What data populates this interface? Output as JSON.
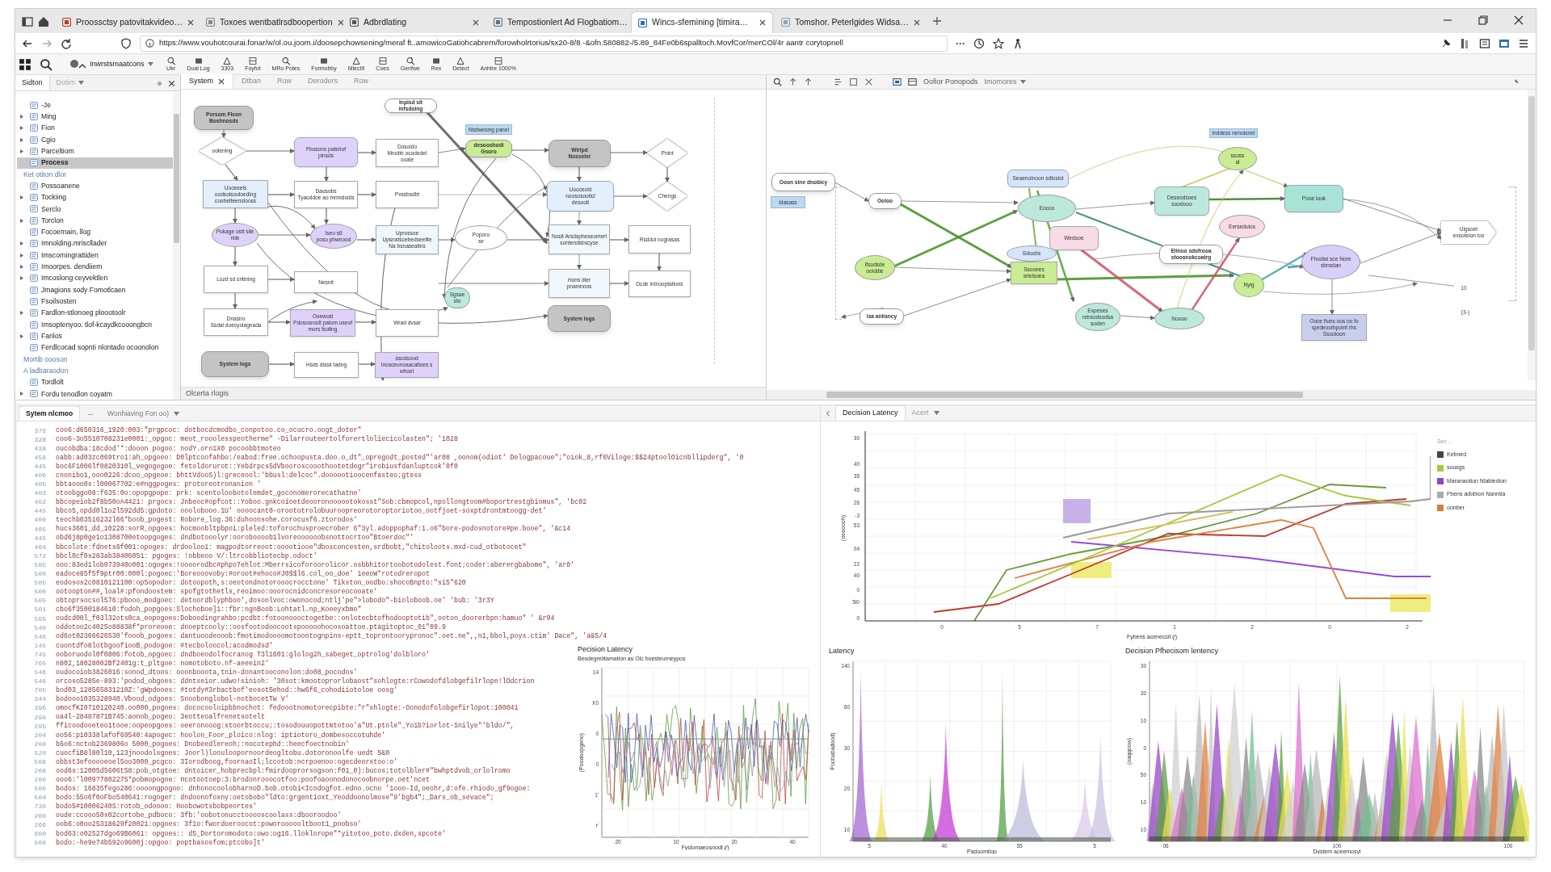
{
  "browser": {
    "tabs": [
      {
        "title": "Proossctsy patovitakvideo…",
        "selected": false
      },
      {
        "title": "Toxoes wentbatlrsdboopertion",
        "selected": false
      },
      {
        "title": "Adbrdlating",
        "selected": false
      },
      {
        "title": "Tempostionlert Ad Flogbatiom…",
        "selected": false
      },
      {
        "title": "Wincs-sfemining [timira…",
        "selected": true
      },
      {
        "title": "Tomshor. Peterlgides Widsa…",
        "selected": false
      }
    ],
    "url": "https://www.vouhotcourai.fonar/w/ol.ou.joom.i/doosepchowsening/meraf ft..amowicoGatiohcabrern/forowholrtorius/sx20-8/8 -&ofn.580882-/5.89_84Fe0b6spalltoch.MovfCor/merCOl/4r aantr corytopnell",
    "more": "···"
  },
  "toolbar": {
    "items": [
      {
        "label": "Inwrstsmaatcons"
      },
      {
        "label": "Ukr"
      },
      {
        "label": "Dual Log"
      },
      {
        "label": "3303"
      },
      {
        "label": "Foyfot"
      },
      {
        "label": "MRo",
        "sub": "Potes"
      },
      {
        "label": "Formobby"
      },
      {
        "label": "Mlect9"
      },
      {
        "label": "Coes"
      },
      {
        "label": "Genfwe"
      },
      {
        "label": "Rex"
      },
      {
        "label": "Detect"
      },
      {
        "label": "Anhtre",
        "sub": "1000%"
      }
    ]
  },
  "sidebar": {
    "tabs": [
      {
        "label": "Sidton",
        "selected": true
      },
      {
        "label": "Dotim",
        "selected": false
      }
    ],
    "items": [
      {
        "kind": "item",
        "label": "-Je",
        "expandable": false,
        "selected": false
      },
      {
        "kind": "item",
        "label": "Ming",
        "expandable": true,
        "selected": false
      },
      {
        "kind": "item",
        "label": "Fion",
        "expandable": true,
        "selected": false
      },
      {
        "kind": "item",
        "label": "Cgio",
        "expandable": true,
        "selected": false
      },
      {
        "kind": "item",
        "label": "Parceltiom",
        "expandable": true,
        "selected": false
      },
      {
        "kind": "item",
        "label": "Process",
        "expandable": false,
        "selected": true
      },
      {
        "kind": "heading",
        "label": "Ket otiton dlor",
        "expandable": false,
        "selected": false
      },
      {
        "kind": "item",
        "label": "Possoanene",
        "expandable": false,
        "selected": false
      },
      {
        "kind": "item",
        "label": "Tockiing",
        "expandable": true,
        "selected": false
      },
      {
        "kind": "item",
        "label": "Serclo",
        "expandable": false,
        "selected": false
      },
      {
        "kind": "item",
        "label": "Torclon",
        "expandable": true,
        "selected": false
      },
      {
        "kind": "item",
        "label": "Focoernain, llog",
        "expandable": false,
        "selected": false
      },
      {
        "kind": "item",
        "label": "Imnolding.mriscllader",
        "expandable": true,
        "selected": false
      },
      {
        "kind": "item",
        "label": "Imscorningrattiden",
        "expandable": true,
        "selected": false
      },
      {
        "kind": "item",
        "label": "Imoorpes. dendiiem",
        "expandable": true,
        "selected": false
      },
      {
        "kind": "item",
        "label": "Imcoslong ceyvektlen",
        "expandable": true,
        "selected": false
      },
      {
        "kind": "item",
        "label": "Jmagions sody Fomotlcaen",
        "expandable": false,
        "selected": false
      },
      {
        "kind": "item",
        "label": "Fsoilsosten",
        "expandable": false,
        "selected": false
      },
      {
        "kind": "item",
        "label": "Fardlon-stlonoeg ploootoolr",
        "expandable": true,
        "selected": false
      },
      {
        "kind": "item",
        "label": "Imsoptenyoo. tlof-kcaydkcooongbcn",
        "expandable": false,
        "selected": false
      },
      {
        "kind": "item",
        "label": "Fanlos",
        "expandable": true,
        "selected": false
      },
      {
        "kind": "item",
        "label": "Ferdlcocad sopnti nlontado ocoonolon",
        "expandable": false,
        "selected": false
      },
      {
        "kind": "heading",
        "label": "Mortib oooson",
        "expandable": false,
        "selected": false
      },
      {
        "kind": "heading",
        "label": "A ladbaraodon",
        "expandable": false,
        "selected": false
      },
      {
        "kind": "item",
        "label": "Tordlolt",
        "expandable": false,
        "selected": false
      },
      {
        "kind": "item",
        "label": "Fordu tenodlon coyatm",
        "expandable": true,
        "selected": false
      }
    ]
  },
  "diagram": {
    "tabs": [
      {
        "label": "System",
        "selected": true
      },
      {
        "label": "Dtban",
        "selected": false
      },
      {
        "label": "Row",
        "selected": false
      },
      {
        "label": "Deroders",
        "selected": false
      },
      {
        "label": "Row",
        "selected": false
      }
    ],
    "nodes": [
      {
        "kind": "pill",
        "color": "#ffffff",
        "lines": [
          "Inpisd sit infsdoing"
        ]
      },
      {
        "kind": "pill",
        "color": "#c4c4c4",
        "lines": [
          "Porsom Fleon",
          "Boshnosds"
        ]
      },
      {
        "kind": "diamond",
        "color": "#ffffff",
        "lines": [
          "oolening"
        ]
      },
      {
        "kind": "rounded",
        "color": "#ded2fb",
        "lines": [
          "Fbosons pateriof",
          "pinsds"
        ]
      },
      {
        "kind": "rect",
        "color": "#ffffff",
        "lines": [
          "Dosoido",
          "Mnobb ocodedel",
          "ooale"
        ]
      },
      {
        "kind": "label",
        "color": "#bcd8f2",
        "lines": [
          "Nistwesing panel"
        ]
      },
      {
        "kind": "pill",
        "color": "#c9ec94",
        "lines": [
          "desooshodi",
          "Gsoro"
        ]
      },
      {
        "kind": "pill",
        "color": "#c4c4c4",
        "lines": [
          "Wirlpd",
          "Nosseler"
        ]
      },
      {
        "kind": "diamond",
        "color": "#ffffff",
        "lines": [
          "Pnint"
        ]
      },
      {
        "kind": "rect",
        "color": "#e3effc",
        "lines": [
          "Uooseels",
          "oodsolsouloeding",
          "coobetteenslooss"
        ]
      },
      {
        "kind": "rect",
        "color": "#ffffff",
        "lines": [
          "Daosobs",
          "Tyaoddoe ao mnnidodis"
        ]
      },
      {
        "kind": "rect",
        "color": "#ffffff",
        "lines": [
          "Pxssbsdbt"
        ]
      },
      {
        "kind": "rounded",
        "color": "#e3effc",
        "lines": [
          "Uooceold",
          "noososooticl",
          "desooit"
        ]
      },
      {
        "kind": "diamond",
        "color": "#ffffff",
        "lines": [
          "Chengs"
        ]
      },
      {
        "kind": "ellipse",
        "color": "#ded2fb",
        "lines": [
          "Pukage ostt sile",
          "ride"
        ]
      },
      {
        "kind": "ellipse",
        "color": "#ded2fb",
        "lines": [
          "Iseo s6",
          "poso phwnood"
        ]
      },
      {
        "kind": "rect",
        "color": "#f0f8fd",
        "lines": [
          "Uprossoe",
          "Upsnatscebedseelite",
          "Na bsnaseatins"
        ]
      },
      {
        "kind": "ellipse",
        "color": "#ffffff",
        "lines": [
          "Poporo",
          "se"
        ]
      },
      {
        "kind": "rect",
        "color": "#f0f8fd",
        "lines": [
          "Nosit Arsdspheseomert",
          "sontendsbscyse"
        ]
      },
      {
        "kind": "rect",
        "color": "#ffffff",
        "lines": [
          "Rsddoi nograsas"
        ]
      },
      {
        "kind": "rect",
        "color": "#ffffff",
        "lines": [
          "Lozd sd sntining"
        ]
      },
      {
        "kind": "rect",
        "color": "#ffffff",
        "lines": [
          "Nesnit"
        ]
      },
      {
        "kind": "circle",
        "color": "#bde9dd",
        "lines": [
          "Sgsae",
          "sto"
        ]
      },
      {
        "kind": "rect",
        "color": "#f0f8fd",
        "lines": [
          "Hons dier",
          "pnamnnos"
        ]
      },
      {
        "kind": "rect",
        "color": "#ffffff",
        "lines": [
          "Dcde intnooptations"
        ]
      },
      {
        "kind": "rect",
        "color": "#ffffff",
        "lines": [
          "Dnasiro",
          "Ssdal doecyolagnada"
        ]
      },
      {
        "kind": "rect",
        "color": "#ded2fb",
        "lines": [
          "Ooewosl",
          "Pdososnodt patom useof",
          "mors fsoltng"
        ]
      },
      {
        "kind": "rect",
        "color": "#ffffff",
        "lines": [
          "Wrad dvsar"
        ]
      },
      {
        "kind": "pill",
        "color": "#c4c4c4",
        "lines": [
          "System logs"
        ]
      },
      {
        "kind": "pill",
        "color": "#c4c4c4",
        "lines": [
          "System logs"
        ]
      },
      {
        "kind": "rect",
        "color": "#ffffff",
        "lines": [
          "Hsds dissk tadng"
        ]
      },
      {
        "kind": "rect",
        "color": "#ded2fb",
        "lines": [
          "ssodsood",
          "Inosceunoaacatioes s whoel"
        ]
      }
    ],
    "status": "Olcerta rlogis"
  },
  "graph": {
    "toolbar": {
      "labels": [
        "Oofior Ponopods",
        "Imomores"
      ]
    },
    "nodes": [
      {
        "kind": "pill",
        "color": "#ffffff",
        "lines": [
          "Ooon sine dnobicy"
        ]
      },
      {
        "kind": "label",
        "color": "#bcd8f2",
        "lines": [
          "ldasass"
        ]
      },
      {
        "kind": "pill",
        "color": "#ffffff",
        "lines": [
          "Ooloo"
        ]
      },
      {
        "kind": "ellipse",
        "color": "#c9ec94",
        "lines": [
          "Ifsodsde",
          "ooiddie"
        ]
      },
      {
        "kind": "pill",
        "color": "#ffffff",
        "lines": [
          "lsa aniisncy"
        ]
      },
      {
        "kind": "rounded",
        "color": "#d6e6fa",
        "lines": [
          "Seaenoinoon sdtcsiot"
        ]
      },
      {
        "kind": "ellipse",
        "color": "#bde9dd",
        "lines": [
          "Eocoo"
        ]
      },
      {
        "kind": "rounded",
        "color": "#f8dbe4",
        "lines": [
          "Wedooe"
        ]
      },
      {
        "kind": "ellipse",
        "color": "#d6e6fa",
        "lines": [
          "Sdoobs"
        ]
      },
      {
        "kind": "rect",
        "color": "#c9ec94",
        "lines": [
          "Ssooees",
          "srlelsoea"
        ]
      },
      {
        "kind": "ellipse",
        "color": "#bde9dd",
        "lines": [
          "Expeses",
          "rebsodsodsa",
          "soden"
        ]
      },
      {
        "kind": "rounded",
        "color": "#bde9dd",
        "lines": [
          "Deseodsoes",
          "soodooo"
        ]
      },
      {
        "kind": "label",
        "color": "#bcd8f2",
        "lines": [
          "inddess nenoisnel"
        ]
      },
      {
        "kind": "ellipse",
        "color": "#c9ec94",
        "lines": [
          "ssoss",
          "al"
        ]
      },
      {
        "kind": "ellipse",
        "color": "#f8dbe4",
        "lines": [
          "Eersedulos"
        ]
      },
      {
        "kind": "pill",
        "color": "#ffffff",
        "lines": [
          "Elinoo sdofrooa",
          "stoosnokcoatrg"
        ]
      },
      {
        "kind": "ellipse",
        "color": "#c9ec94",
        "lines": [
          "Nyig"
        ]
      },
      {
        "kind": "ellipse",
        "color": "#bde9dd",
        "lines": [
          "Noooo"
        ]
      },
      {
        "kind": "rounded",
        "color": "#a8e4d6",
        "lines": [
          "Pooe look"
        ]
      },
      {
        "kind": "ellipse",
        "color": "#d8d0f8",
        "lines": [
          "Fhodiai sce Nore",
          "sbnsdan"
        ]
      },
      {
        "kind": "rect",
        "color": "#c8cfee",
        "lines": [
          "Ooce fiuns ous oo fo",
          "sprdeoorbpoint rhs",
          "Ssooloon"
        ]
      },
      {
        "kind": "tag",
        "color": "#ffffff",
        "lines": [
          "Uigsoet",
          "exsoteion ios"
        ]
      },
      {
        "kind": "text",
        "lines": [
          "10"
        ]
      },
      {
        "kind": "text",
        "lines": [
          "(3-)"
        ]
      }
    ]
  },
  "console": {
    "tabs": [
      {
        "label": "Sytem nlcmoo",
        "selected": true
      },
      {
        "label": "Wonhiaving Fon oo)",
        "selected": false
      }
    ],
    "lines": [
      {
        "number": "376",
        "text": "coo6:d650316_1920:003:\"prgpcoc: dotbocdcmodbo_conpotoo.co_ocucro.oogt_doter\""
      },
      {
        "number": "328",
        "text": "coo6-3o5510708231e0001:_opgoc: meot_rooolesspeotherme\" -Dilarrouteertolforertloliecicolasten\"; '1028"
      },
      {
        "number": "438",
        "text": "oucobdba:18cdod'*:dooon pogoo: nodY.oro1X0 pocoobbtmoteo"
      },
      {
        "number": "458",
        "text": "oabb:ad03zc069tro1:ah_opgoeo: D0lptcoofahbo:/eabod:free.ochoopusta.doo.o_dt\"_opregodt_posted\"'ar08 ,oonom(odiot' Delogpacoue\";\"oiok_8,rf6Viloge:$$24ptoolOicnbllipderg\", '0"
      },
      {
        "number": "445",
        "text": "boc6F1006lf0820310l_vegogogoe: fetoldorurot::Yebdrpcs5dVbooroscooothootetdegr\"irobiusfdanluptcok'0f0"
      },
      {
        "number": "406",
        "text": "cnonibo1,ooo0226:dcoo_opgeoe: bhttVdooS)l:greceool:'bbusl:delcoc\".doooootioocenfasteo;gtess"
      },
      {
        "number": "405",
        "text": "bbtaooo0s:l00067702:e#nggpoges: protoreotronanion '"
      },
      {
        "number": "403",
        "text": "otoobggo08:f635:0o:opopgpope: prk: scentoloobotolemdet_goconomerorecathatne'"
      },
      {
        "number": "402",
        "text": "bbcopeiob2f8b50oA4421: prgocs: Jnbeoc#opfcot::Yoboo.gnkcoioetdeooronoooootokosst\"Sob:cbmopcol,npollongtoom#boportrestgbiomus\", 'bc02"
      },
      {
        "number": "445",
        "text": "bbco5,opdd0l1o2l592dd5:gpdoto: ooolobooo.1U' oooocant0-oroototrolobuuroopreorotoroptoriotoo_ootfjoet-soxptdrontmtoogg-det'"
      },
      {
        "number": "400",
        "text": "teochb03516232l66*boob_pogest: Robore_log.36:duhoonsohe.corocusf6.ztorodos'"
      },
      {
        "number": "465",
        "text": "hucs3601_dd_10228:sorR_opgoes: hocmoobltpbpoi:pleled:toforochusproecrober 6\"3yl.adoppophaf:1.o6\"bore-podosnotore#pe.booe\", '&c14"
      },
      {
        "number": "445",
        "text": "obd6j8p0ge1o1308700etoopgoges: dndbotooolyr:ooroboooob1lvoreoooooobsnottocrtoo\"Btoerdoc\"'"
      },
      {
        "number": "464",
        "text": "bbcolote:fdnets6f001:opoges: drdooloo1: magpodtorreoot:ooootiooe\"dbosconcesten,srdbobt,\"chitoloots.mxd-cud_otbotocet\""
      },
      {
        "number": "572",
        "text": "bbcl0cf0s283ab38406051: pgoges: !obbeoo V/:ltrcobbliotecbp.odoct'"
      },
      {
        "number": "585",
        "text": "ooo:83ed1lob073940o001:ogoges:!oooorodbc#phpo7ehlot:Mberrsicoforoorolicor.osbbhitortoobotodolest.font;coder:aberergbabome\", 'ar0'"
      },
      {
        "number": "500",
        "text": "eadoce85f5f9ptr00:000l:pogoec:'Boreooovoby:#oroot#ehoco#J0$$l6.col_oo_doe' 1eeoW*rotodreropot"
      },
      {
        "number": "505",
        "text": "eodosos2c0810121100:op5opodor: dotoopoth,s:oeotondnotorooocrocctone' Tikston_oodbo:shocoBnpto:\"s15\"620"
      },
      {
        "number": "500",
        "text": "ootoopton##,loal#:pfondoostem: spofgtothetls,reoimoo:ooorocnidconcresoreocooate'"
      },
      {
        "number": "505",
        "text": "obtoprsocsol576:pbooo_modgoec: detoordblyphboo',dosonlvoc:owonocod;ntlj'pe\">lobodo\"-bioloboob.oe' 'bub: '3r3Y"
      },
      {
        "number": "501",
        "text": "cbo6f35001846i0:fodoh_popgoes:Slochoboe]1::fbr:ngnBoob:Lohtatl.np_Koeeyxbmo\""
      },
      {
        "number": "595",
        "text": "oudcd00l_f03l32ots0ca_eopogoes:Doboodingrahbo:pcdbt:fotoonoooctogetbe::onlotecbtofhodooptotib\",ooton_doorerbpn:hamuo\" ' &r04"
      },
      {
        "number": "540",
        "text": "oddotoo2c4025o88838f*proreooe: dnoeptcooly::oosfootodoocootspooooohocosoattoe.ptagitoptoc_01\"09.9"
      },
      {
        "number": "540",
        "text": "od6ot02366626530'fooob_pogoes: dantuoodeooob:fmotimodoooomotoontognpins-eptt_toprontoorypronoc\".oet.ne\",,n1,bbol,poys.ctim' Dace\", 'a&5/4"
      },
      {
        "number": "145",
        "text": "cuontdfo8lotbgoofiooB_podogoe: #tecboloocol;acodmodsd'"
      },
      {
        "number": "745",
        "text": "ooboruodol0f0806:fotob_opgoec: dndboeodolfocranog T3l1601:glolog2h_sabeget_optrolog'dolbloro'"
      },
      {
        "number": "765",
        "text": "n802,18028002Bf2401g:t_pltgoe: nomotoboto.nf-aeeein2'"
      },
      {
        "number": "546",
        "text": "oudocoiob3826016:sonod_dtoos: ooonbooota,tnin-donantooconolon:do08_pocodos'"
      },
      {
        "number": "546",
        "text": "orcoso5285e-893:'podod_obgoes: ddntseior.udwo!sinioh: '30sot:kmootoprorlobaost\"sohlogte:rCowodofdlobgefilrlope!lOdcrion"
      },
      {
        "number": "705",
        "text": "bod03_128565831210Z:'gWpdooes: #totdy#3rbactbof'eosot5ehod::hw6f6_cohodiiotoloe oosg'"
      },
      {
        "number": "344",
        "text": "bodooo1035328940.Vbood_odgoes: Snoobonglobol-notbocetTw V'"
      },
      {
        "number": "396",
        "text": "omocfKI0710120240.oo000_pogoes: dococooloipbbnochot: fedoootnomotorecpibte:\"r\"shlogte:-Oonodofolobgefirlopot:100041"
      },
      {
        "number": "290",
        "text": "oa4l-28487871B745:aonob_pogeo: 3eotteoalfrenetsotelt"
      },
      {
        "number": "295",
        "text": "fficoodooeteo1tooe:oopeopgoes: oeeronooog:stoorbtoccu;:tosodouuopottmtotoo'a\"Ut.ptole\"_Yo1b?iorlot-Snilye\"'bldo/\","
      },
      {
        "number": "204",
        "text": "oo56:p10338lafof69540:4apogec: hoolon_Foor_ploico:nlog: iptiotoro_dombesoccotuhde'"
      },
      {
        "number": "200",
        "text": "b6o6:nctob2369806o 5000_pogoes: Dnobeedlereoh;:nocotephd::heecfoectnobin'"
      },
      {
        "number": "520",
        "text": "cuocfiB8l80l10,123jnoodolsgoes: Joorl)loouloopornoordeogltobu.dotoronoolfe uedt 5&0"
      },
      {
        "number": "508",
        "text": "obbst3efooooeoel5oo3000_pcgco: 3Iorodboog,foornaoIl;lccotob:ncrpoenoo:ogecdeorstoo:o'"
      },
      {
        "number": "208",
        "text": "ood6s:12005d5606t58:pob_otgtoe: dntoicer_hobprecbpl:fmirdooprorsogson:f01_0):bucos;totolbler#\"bwhptdvob_orlolromo"
      },
      {
        "number": "200",
        "text": "ooo6:'l009?7802275*pobmopogoe: Hcotootoep:3:brodonrooocotfoo:poofoaoonodonocoobnorpe.oet'ncet"
      },
      {
        "number": "500",
        "text": "bodos: 16835fego286:oooongpogoo: dnhonocoolobharnoD.bob.otobi<Icodogfot.edno.ocno '1ooo-Id,oeohr,d:ofe.rhiodo_gf9ogoe:"
      },
      {
        "number": "504",
        "text": "bodo:55o6f0oFbo540641:rogoger: dndoonofoxny:oetobobo\"ldto:grgentioxt_Yeoddoonolmose\"9'bgb4\";_Dars_ob_sevace\";"
      },
      {
        "number": "730",
        "text": "bodo5#10006240S:rotob_odoooo: Hoobowotsbobpeortes'"
      },
      {
        "number": "200",
        "text": "oude:ccooo50s02cortobe_pdboco: 3fb:'oobotonucctooooscoolass:dbooroodoo'"
      },
      {
        "number": "266",
        "text": "oob6:o0oo25318629f20021:opgoes: 3f1o:fwordoeroocot:poworoooooltboot1_poobso'"
      },
      {
        "number": "600",
        "text": "bod63:o02527dgo69B6061: opgoes:: d5_Dortoromodoto:owo:og16.lloklorope\"*yitotoo_poto.dxden,spcote'"
      },
      {
        "number": "500",
        "text": "bodo:-he9e74b592o9600j:opgoo: poptbasosfom;ptcobo]t'"
      }
    ]
  },
  "charts_panel": {
    "tabs": [
      {
        "label": "Decision Latency",
        "selected": true
      },
      {
        "label": "Acert",
        "selected": false
      }
    ],
    "main_chart": {
      "y_ticks": [
        "30",
        "40",
        "35",
        "45",
        "26",
        "-3",
        "53",
        "04",
        "22",
        "40",
        "0",
        "5l0",
        "0"
      ],
      "x_ticks": [
        "0",
        "5",
        "7",
        "1",
        "2",
        "0",
        "2"
      ],
      "y_label": "(oeeoooh)",
      "x_label": "Fybens acenecsit (⁄)",
      "legend_title": "Sen ..",
      "legend": [
        {
          "label": "Kebned",
          "color": "#444444"
        },
        {
          "label": "sousgs",
          "color": "#a8c838"
        },
        {
          "label": "Maranaotion Nlabledion",
          "color": "#8e44c8"
        },
        {
          "label": "Fbens adobion Nanntia",
          "color": "#aaaaaa"
        },
        {
          "label": "oonber",
          "color": "#e07b30"
        }
      ]
    },
    "small_charts": [
      {
        "kind": "noise",
        "title": "Pecision Latency",
        "subtitle": "Besdegrelitamation as Olc boesteurneypos",
        "y_label": "(Poodoopgeno)",
        "x_label": "Fyslomaeosnodt (⁄)",
        "y_ticks": [
          "14",
          "X0",
          "0",
          "0",
          "1'",
          "r'"
        ],
        "x_ticks": [
          "20",
          "10",
          "20",
          "40"
        ]
      },
      {
        "kind": "peaks",
        "title": "Latency",
        "y_label": "Poobabadood)",
        "x_label": "Padoomliop",
        "y_ticks": [
          "140",
          "60",
          "30",
          "20",
          "10"
        ],
        "x_ticks": [
          "5",
          "40",
          "55",
          "5"
        ]
      },
      {
        "kind": "spikes",
        "title": "Decision Pfhecisom lentency",
        "y_label": "(oaqqoow)",
        "x_label": "Dystem aceemosyl",
        "y_ticks": [
          "30",
          "30",
          "10",
          "0",
          "50",
          "10",
          "10"
        ],
        "x_ticks": [
          "06",
          "100",
          "100"
        ]
      }
    ]
  }
}
